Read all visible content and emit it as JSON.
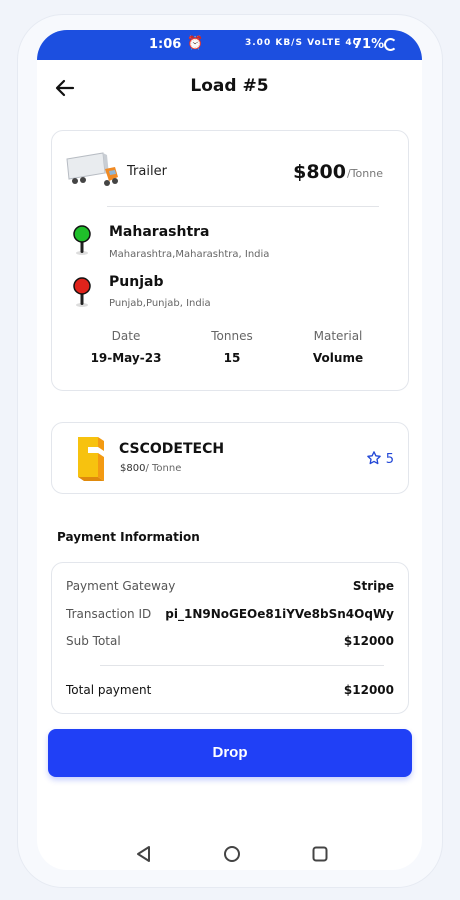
{
  "status_bar": {
    "time": "1:06",
    "alarm_icon": "alarm-icon",
    "network": "3.00 KB/S  VoLTE  4G",
    "battery": "71%"
  },
  "header": {
    "back_icon": "arrow-left-icon",
    "title": "Load #5"
  },
  "load": {
    "vehicle_icon": "truck-icon",
    "vehicle": "Trailer",
    "price": "$800",
    "price_unit": "/Tonne",
    "origin": {
      "name": "Maharashtra",
      "address": "Maharashtra,Maharashtra, India",
      "pin_color": "#1fbf2a"
    },
    "destination": {
      "name": "Punjab",
      "address": "Punjab,Punjab, India",
      "pin_color": "#e0231b"
    },
    "meta": [
      {
        "label": "Date",
        "value": "19-May-23"
      },
      {
        "label": "Tonnes",
        "value": "15"
      },
      {
        "label": "Material",
        "value": "Volume"
      }
    ]
  },
  "company": {
    "name": "CSCODETECH",
    "price": "$800",
    "price_unit": "/ Tonne",
    "rating": "5",
    "rating_icon": "star-outline-icon",
    "logo_colors": [
      "#f7c20f",
      "#f39a12"
    ]
  },
  "payment": {
    "section_title": "Payment Information",
    "rows": [
      {
        "label": "Payment Gateway",
        "value": "Stripe"
      },
      {
        "label": "Transaction ID",
        "value": "pi_1N9NoGEOe81iYVe8bSn4OqWy"
      },
      {
        "label": "Sub Total",
        "value": "$12000"
      }
    ],
    "total_label": "Total payment",
    "total_value": "$12000"
  },
  "actions": {
    "drop_label": "Drop",
    "accent": "#2040f6"
  },
  "nav": {
    "back": "triangle-back-icon",
    "home": "circle-home-icon",
    "recents": "square-recents-icon"
  }
}
